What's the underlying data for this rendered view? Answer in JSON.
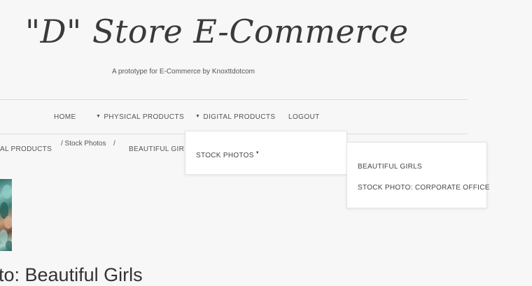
{
  "header": {
    "title": "\"D\" Store E-Commerce",
    "tagline": "A prototype for E-Commerce by Knoxttdotcom"
  },
  "nav": {
    "home": "HOME",
    "physical": "PHYSICAL PRODUCTS",
    "digital": "DIGITAL PRODUCTS",
    "logout": "LOGOUT"
  },
  "breadcrumb": {
    "physical_partial": "AL PRODUCTS",
    "stock_photos": "/ Stock Photos",
    "separator": "/",
    "current": "BEAUTIFUL GIRLS"
  },
  "dropdown_digital": {
    "items": [
      {
        "label": "STOCK PHOTOS",
        "has_submenu": true
      }
    ]
  },
  "dropdown_stock_photos": {
    "items": [
      {
        "label": "BEAUTIFUL GIRLS"
      },
      {
        "label": "STOCK PHOTO: CORPORATE OFFICE"
      }
    ]
  },
  "product": {
    "title_partial": "to: Beautiful Girls"
  },
  "icons": {
    "menu_caret": "caret-down-icon"
  },
  "colors": {
    "background": "#f7f7f7",
    "text": "#555555",
    "dropdown_bg": "#ffffff"
  }
}
